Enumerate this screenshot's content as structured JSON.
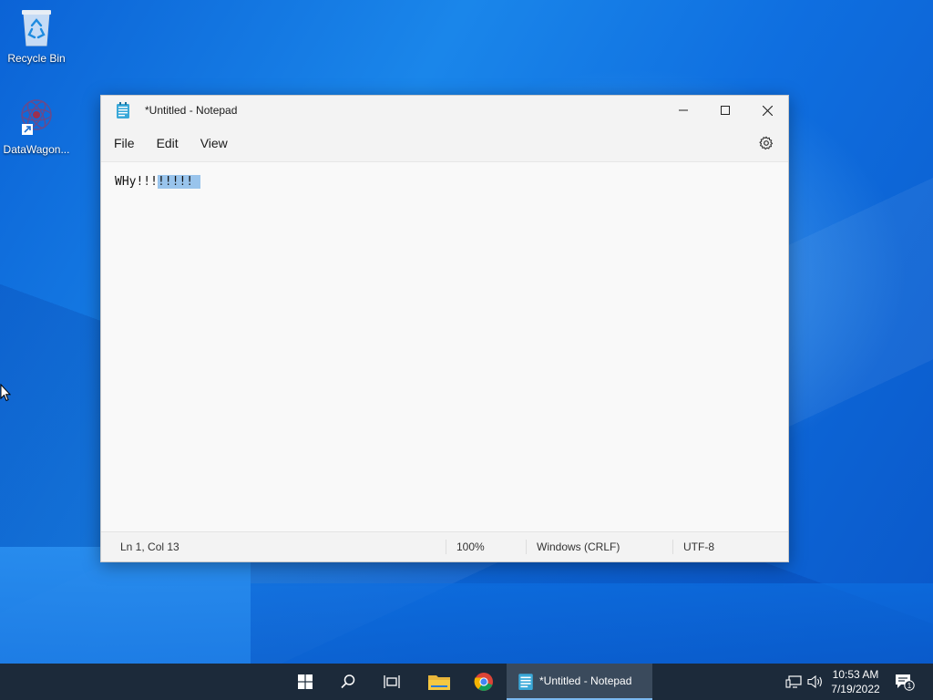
{
  "desktop": {
    "icons": [
      {
        "label": "Recycle Bin",
        "icon": "recycle-bin-icon"
      },
      {
        "label": "DataWagon...",
        "icon": "datawagon-icon"
      }
    ]
  },
  "window": {
    "title": "*Untitled - Notepad",
    "menu": {
      "file": "File",
      "edit": "Edit",
      "view": "View"
    },
    "editor": {
      "text_plain": "WHy!!!",
      "text_selected": "!!!!!"
    },
    "status": {
      "position": "Ln 1, Col 13",
      "zoom": "100%",
      "line_ending": "Windows (CRLF)",
      "encoding": "UTF-8"
    }
  },
  "taskbar": {
    "active_app_label": "*Untitled - Notepad",
    "clock_time": "10:53 AM",
    "clock_date": "7/19/2022",
    "notification_count": "1"
  },
  "colors": {
    "selection": "#99c4ec",
    "taskbar": "#1c2a3a",
    "desktop_accent": "#1a86ea"
  }
}
